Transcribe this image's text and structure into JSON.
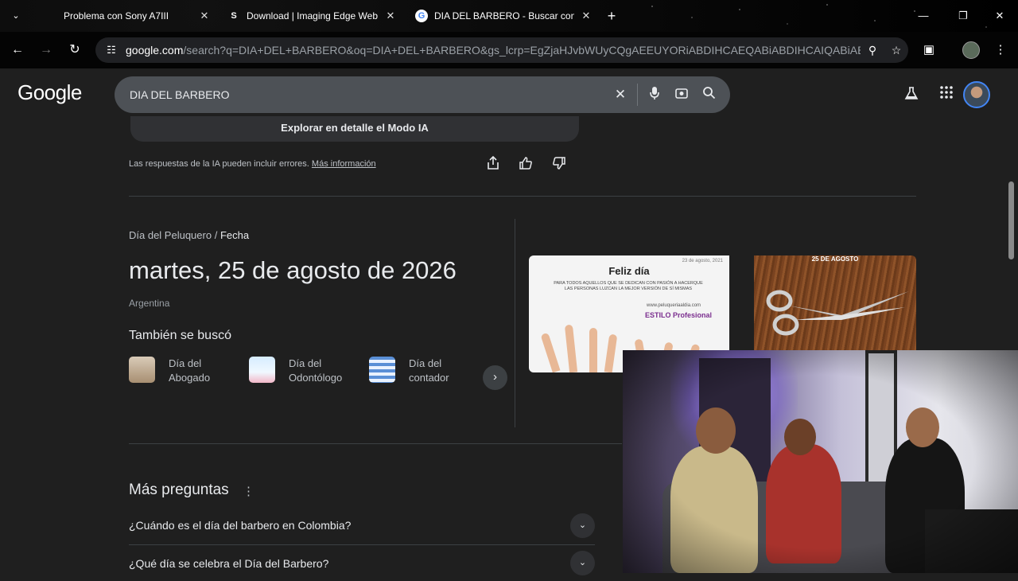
{
  "browser": {
    "tabs": [
      {
        "label": "Problema con Sony A7III",
        "favicon": "",
        "active": false
      },
      {
        "label": "Download | Imaging Edge Web",
        "favicon": "S",
        "active": false
      },
      {
        "label": "DIA DEL BARBERO - Buscar con",
        "favicon": "G",
        "active": true
      }
    ],
    "url_host": "google.com",
    "url_path": "/search?q=DIA+DEL+BARBERO&oq=DIA+DEL+BARBERO&gs_lcrp=EgZjaHJvbWUyCQgAEEUYORiABDIHCAEQABiABDIHCAIQABiABDI..."
  },
  "google": {
    "logo": "Google",
    "query": "DIA DEL BARBERO"
  },
  "ai_overview": {
    "explore_label": "Explorar en detalle el Modo IA",
    "disclaimer": "Las respuestas de la IA pueden incluir errores.",
    "more_info": "Más información"
  },
  "knowledge": {
    "breadcrumb_parent": "Día del Peluquero",
    "breadcrumb_sep": "/",
    "breadcrumb_current": "Fecha",
    "date": "martes, 25 de agosto de 2026",
    "country": "Argentina",
    "also_searched_title": "También se buscó",
    "related": [
      {
        "line1": "Día del",
        "line2": "Abogado"
      },
      {
        "line1": "Día del",
        "line2": "Odontólogo"
      },
      {
        "line1": "Día del",
        "line2": "contador"
      }
    ],
    "image1": {
      "title": "Feliz día",
      "date": "23 de agosto, 2021",
      "text": "PARA TODOS AQUELLOS QUE SE DEDICAN CON PASIÓN A HACERQUE LAS PERSONAS LUZCAN LA MEJOR VERSIÓN DE SÍ MISMAS",
      "website": "www.peluqueriaaldia.com",
      "brand": "ESTILO Profesional"
    },
    "image2": {
      "title": "25 DE AGOSTO"
    }
  },
  "more_questions": {
    "title": "Más preguntas",
    "items": [
      "¿Cuándo es el día del barbero en Colombia?",
      "¿Qué día se celebra el Día del Barbero?"
    ]
  },
  "colors": {
    "page_bg": "#1f1f1f",
    "search_bg": "#4d5156",
    "text": "#e8eaed"
  }
}
